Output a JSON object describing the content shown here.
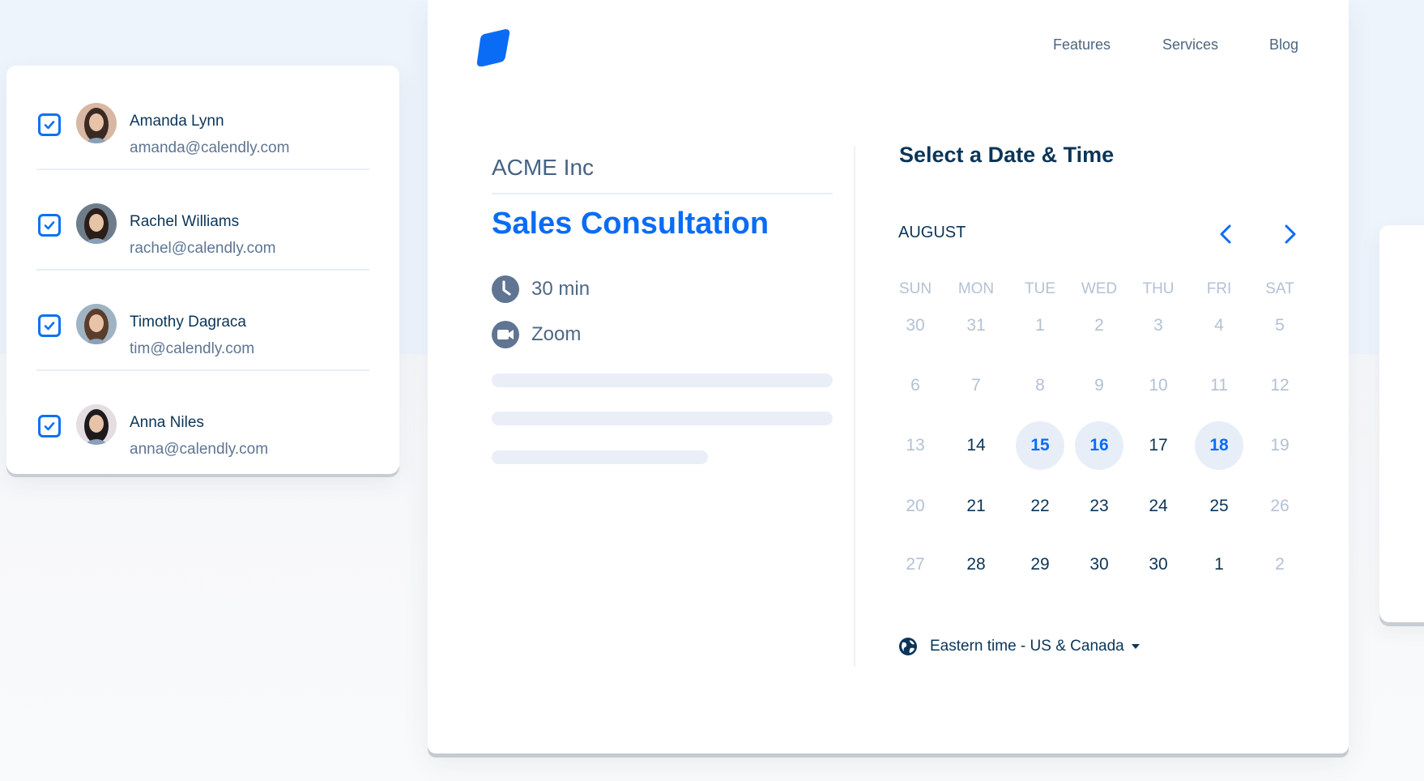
{
  "attendees": [
    {
      "name": "Amanda Lynn",
      "email": "amanda@calendly.com",
      "checked": true
    },
    {
      "name": "Rachel Williams",
      "email": "rachel@calendly.com",
      "checked": true
    },
    {
      "name": "Timothy Dagraca",
      "email": "tim@calendly.com",
      "checked": true
    },
    {
      "name": "Anna Niles",
      "email": "anna@calendly.com",
      "checked": true
    }
  ],
  "header": {
    "logo": "calendly-logo-icon",
    "nav": [
      "Features",
      "Services",
      "Blog"
    ]
  },
  "event": {
    "company": "ACME Inc",
    "title": "Sales Consultation",
    "duration": "30 min",
    "location": "Zoom",
    "duration_icon": "clock-icon",
    "location_icon": "video-camera-icon"
  },
  "picker": {
    "title": "Select a Date & Time",
    "month": "AUGUST",
    "prev_icon": "chevron-left-icon",
    "next_icon": "chevron-right-icon",
    "weekdays": [
      "SUN",
      "MON",
      "TUE",
      "WED",
      "THU",
      "FRI",
      "SAT"
    ],
    "weeks": [
      [
        {
          "d": "30",
          "s": "muted"
        },
        {
          "d": "31",
          "s": "muted"
        },
        {
          "d": "1",
          "s": "muted"
        },
        {
          "d": "2",
          "s": "muted"
        },
        {
          "d": "3",
          "s": "muted"
        },
        {
          "d": "4",
          "s": "muted"
        },
        {
          "d": "5",
          "s": "muted"
        }
      ],
      [
        {
          "d": "6",
          "s": "muted"
        },
        {
          "d": "7",
          "s": "muted"
        },
        {
          "d": "8",
          "s": "muted"
        },
        {
          "d": "9",
          "s": "muted"
        },
        {
          "d": "10",
          "s": "muted"
        },
        {
          "d": "11",
          "s": "muted"
        },
        {
          "d": "12",
          "s": "muted"
        }
      ],
      [
        {
          "d": "13",
          "s": "muted"
        },
        {
          "d": "14",
          "s": "active"
        },
        {
          "d": "15",
          "s": "available"
        },
        {
          "d": "16",
          "s": "available"
        },
        {
          "d": "17",
          "s": "active"
        },
        {
          "d": "18",
          "s": "available"
        },
        {
          "d": "19",
          "s": "muted"
        }
      ],
      [
        {
          "d": "20",
          "s": "muted"
        },
        {
          "d": "21",
          "s": "active"
        },
        {
          "d": "22",
          "s": "active"
        },
        {
          "d": "23",
          "s": "active"
        },
        {
          "d": "24",
          "s": "active"
        },
        {
          "d": "25",
          "s": "active"
        },
        {
          "d": "26",
          "s": "muted"
        }
      ],
      [
        {
          "d": "27",
          "s": "muted"
        },
        {
          "d": "28",
          "s": "active"
        },
        {
          "d": "29",
          "s": "active"
        },
        {
          "d": "30",
          "s": "active"
        },
        {
          "d": "30",
          "s": "active"
        },
        {
          "d": "1",
          "s": "active"
        },
        {
          "d": "2",
          "s": "muted"
        }
      ]
    ],
    "timezone": "Eastern time - US & Canada",
    "timezone_icon": "globe-icon"
  },
  "colors": {
    "brand": "#0a6cf5",
    "text_dark": "#0b3558",
    "text_muted": "#b4c1d4",
    "available_bg": "#e8eef8"
  }
}
